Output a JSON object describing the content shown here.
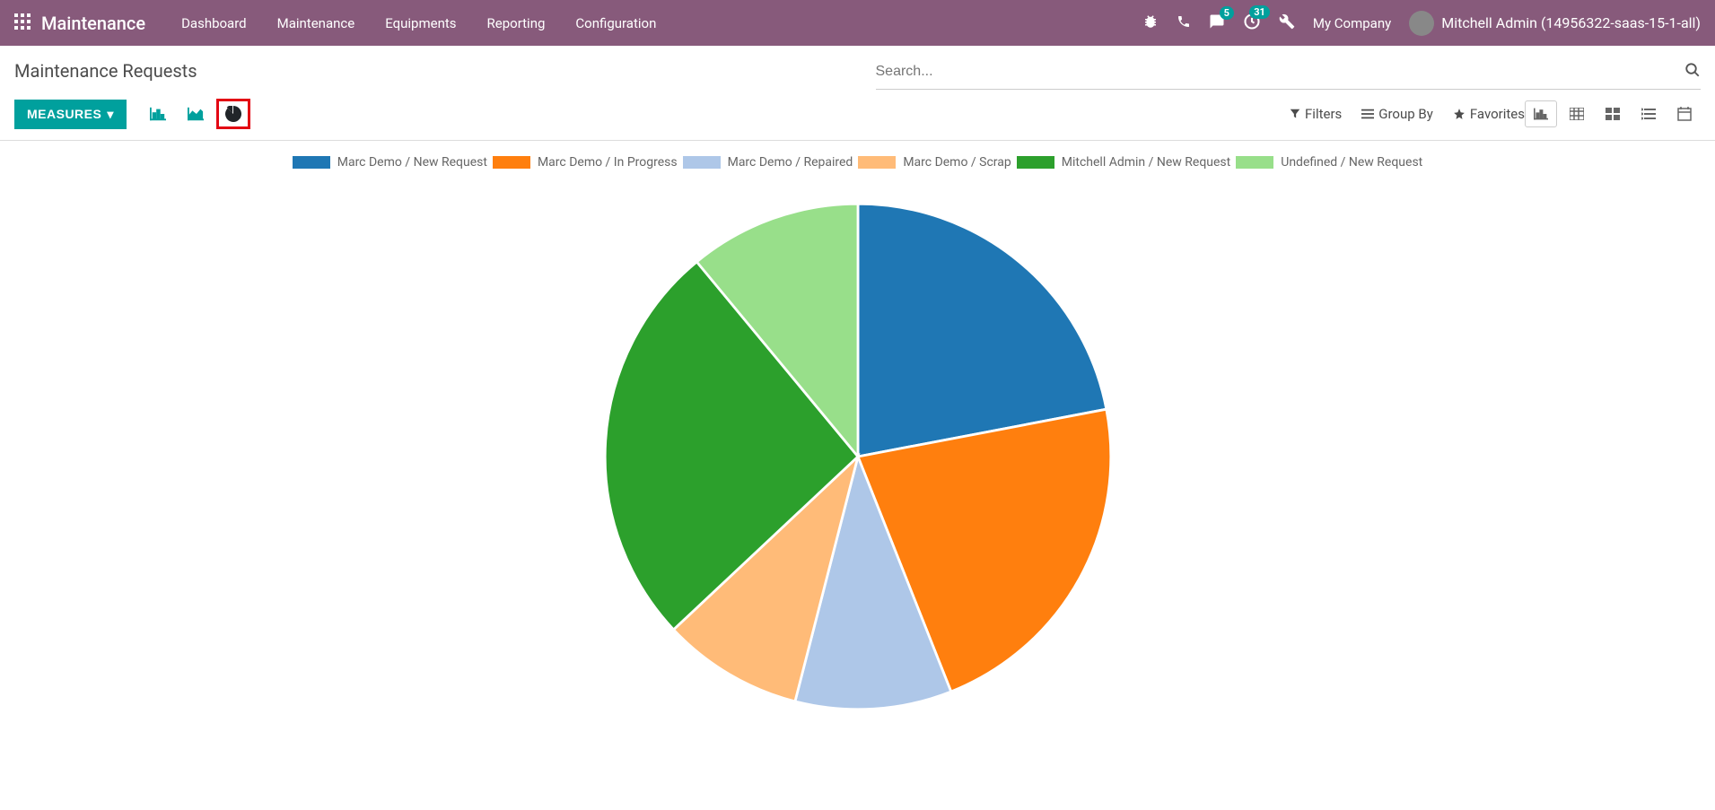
{
  "navbar": {
    "app_name": "Maintenance",
    "links": [
      "Dashboard",
      "Maintenance",
      "Equipments",
      "Reporting",
      "Configuration"
    ],
    "msg_badge": "5",
    "clock_badge": "31",
    "company": "My Company",
    "user": "Mitchell Admin (14956322-saas-15-1-all)"
  },
  "page_title": "Maintenance Requests",
  "search": {
    "placeholder": "Search..."
  },
  "toolbar": {
    "measures_label": "MEASURES",
    "filters_label": "Filters",
    "groupby_label": "Group By",
    "favorites_label": "Favorites"
  },
  "chart_data": {
    "type": "pie",
    "title": "",
    "series": [
      {
        "name": "Marc Demo / New Request",
        "value": 22,
        "color": "#1f77b4"
      },
      {
        "name": "Marc Demo / In Progress",
        "value": 22,
        "color": "#ff7f0e"
      },
      {
        "name": "Marc Demo / Repaired",
        "value": 10,
        "color": "#aec7e8"
      },
      {
        "name": "Marc Demo / Scrap",
        "value": 9,
        "color": "#ffbb78"
      },
      {
        "name": "Mitchell Admin / New Request",
        "value": 26,
        "color": "#2ca02c"
      },
      {
        "name": "Undefined / New Request",
        "value": 11,
        "color": "#98df8a"
      }
    ]
  }
}
